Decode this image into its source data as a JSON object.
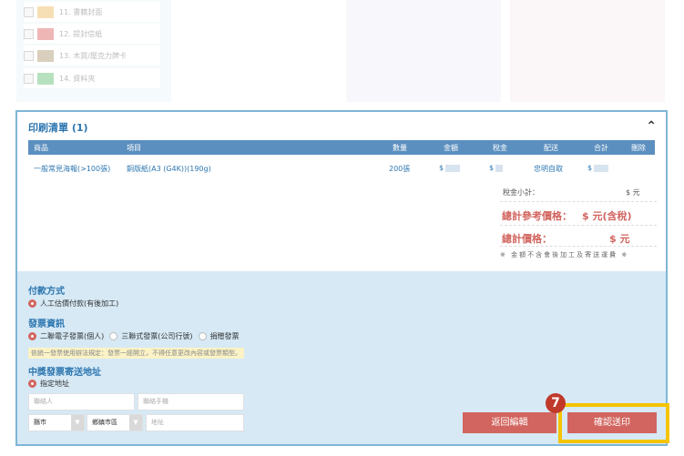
{
  "top_list": {
    "items": [
      {
        "label": "11. 書籍封面"
      },
      {
        "label": "12. 提封信紙"
      },
      {
        "label": "13. 木質/壓克力牌卡"
      },
      {
        "label": "14. 資料夾"
      }
    ]
  },
  "print_list": {
    "title": "印刷清單 (1)",
    "collapse_icon": "chevron-up-icon",
    "headers": {
      "product": "商品",
      "item": "項目",
      "quantity": "數量",
      "amount": "金額",
      "tax": "稅金",
      "delivery": "配送",
      "total": "合計",
      "delete": "刪除"
    },
    "row": {
      "product": "一般常見海報(>100張)",
      "item": "銅版紙(A3 (G4K))(190g)",
      "quantity": "200張",
      "amount": "$",
      "tax": "$",
      "delivery": "忠明自取",
      "total": "$"
    },
    "tax_subtotal_label": "稅金小計：",
    "tax_subtotal_value": "$  元",
    "total_ref_label": "總計參考價格：",
    "total_ref_value": "$    元(含稅)",
    "total_label": "總計價格：",
    "total_value": "$    元",
    "note": "※ 金額不含會後加工及寄送運費 ※"
  },
  "payment": {
    "title": "付款方式",
    "option": "人工估價付款(有後加工)"
  },
  "invoice": {
    "title": "發票資訊",
    "options": [
      "二聯電子發票(個人)",
      "三聯式發票(公司行號)",
      "捐贈發票"
    ],
    "notice": "依統一發票使用辦法規定：發票一經開立，不得任意更改內容或發票類型。"
  },
  "address": {
    "title": "中獎發票寄送地址",
    "option": "指定地址",
    "contact_placeholder": "聯絡人",
    "phone_placeholder": "聯絡手機",
    "city": "縣市",
    "district": "鄉鎮市區",
    "address_placeholder": "地址"
  },
  "actions": {
    "back": "返回編輯",
    "confirm": "確認送印",
    "step_badge": "7"
  },
  "colors": {
    "accent": "#2d76b0",
    "header_bg": "#5b8fbf",
    "button": "#d2655f",
    "highlight": "#f5c400",
    "lower_bg": "#d6e9f5"
  }
}
